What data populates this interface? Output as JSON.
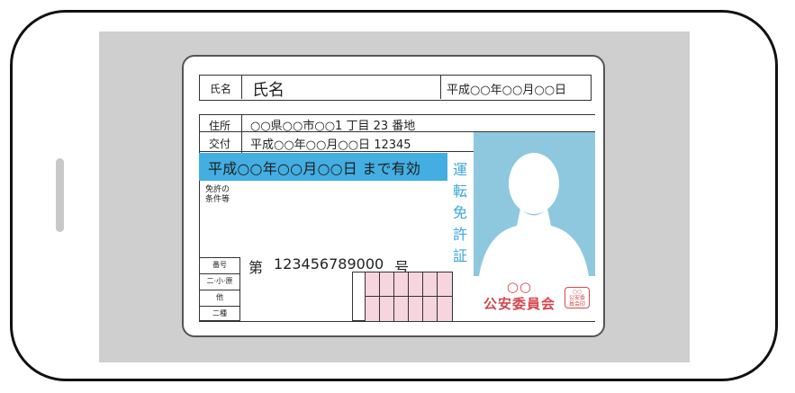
{
  "card": {
    "name_label": "氏名",
    "name_value": "氏名",
    "birth_date": "平成○○年○○月○○日",
    "address_label": "住所",
    "address_value": "○○県○○市○○1 丁目 23 番地",
    "issue_label": "交付",
    "issue_value": "平成○○年○○月○○日 12345",
    "valid_until": "平成○○年○○月○○日 まで有効",
    "card_title_chars": [
      "運",
      "転",
      "免",
      "許",
      "証"
    ],
    "conditions_label_line1": "免許の",
    "conditions_label_line2": "条件等",
    "number_prefix": "第",
    "number_part1": "1234",
    "number_part2": "5678",
    "number_part3": "9000",
    "number_suffix": "号",
    "category_labels": [
      "番号",
      "二·小·原",
      "他",
      "二種"
    ],
    "commission_circles": "○○",
    "commission_name": "公安委員会",
    "seal_line1": "○○",
    "seal_line2": "公安委",
    "seal_line3": "員会印"
  },
  "colors": {
    "valid_band": "#43aee2",
    "photo_bg": "#8dc8df",
    "seal_red": "#d3484e",
    "grid_pink": "#f6d5de",
    "screen_gray": "#cfcfcf"
  },
  "icons": {
    "photo": "person-silhouette-icon"
  }
}
